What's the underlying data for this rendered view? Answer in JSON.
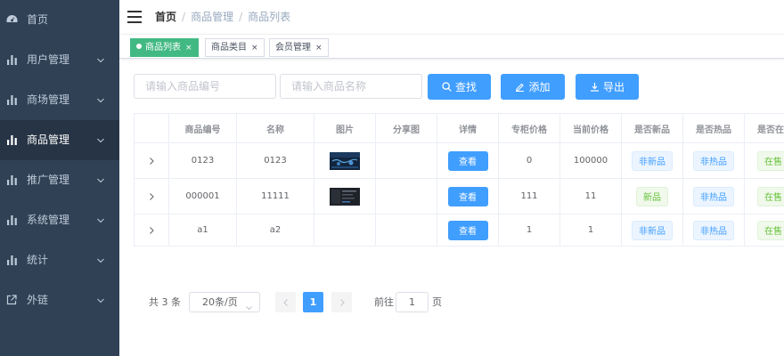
{
  "sidebar": {
    "items": [
      {
        "label": "首页",
        "icon": "dashboard-icon",
        "arrow": false
      },
      {
        "label": "用户管理",
        "icon": "chart-icon",
        "arrow": true
      },
      {
        "label": "商场管理",
        "icon": "chart-icon",
        "arrow": true
      },
      {
        "label": "商品管理",
        "icon": "chart-icon",
        "arrow": true,
        "active": true
      },
      {
        "label": "推广管理",
        "icon": "chart-icon",
        "arrow": true
      },
      {
        "label": "系统管理",
        "icon": "chart-icon",
        "arrow": true
      },
      {
        "label": "统计",
        "icon": "chart-icon",
        "arrow": true
      },
      {
        "label": "外链",
        "icon": "external-link-icon",
        "arrow": true
      }
    ]
  },
  "breadcrumb": [
    "首页",
    "商品管理",
    "商品列表"
  ],
  "tags": [
    {
      "label": "商品列表",
      "active": true
    },
    {
      "label": "商品类目",
      "active": false
    },
    {
      "label": "会员管理",
      "active": false
    }
  ],
  "filters": {
    "code_placeholder": "请输入商品编号",
    "name_placeholder": "请输入商品名称",
    "search_label": "查找",
    "add_label": "添加",
    "export_label": "导出"
  },
  "table": {
    "headers": [
      "",
      "商品编号",
      "名称",
      "图片",
      "分享图",
      "详情",
      "专柜价格",
      "当前价格",
      "是否新品",
      "是否热品",
      "是否在售"
    ],
    "view_label": "查看",
    "rows": [
      {
        "code": "0123",
        "name": "0123",
        "counter_price": "0",
        "current_price": "100000",
        "is_new": "非新品",
        "is_hot": "非热品",
        "on_sale": "在售"
      },
      {
        "code": "000001",
        "name": "11111",
        "counter_price": "111",
        "current_price": "11",
        "is_new": "新品",
        "is_hot": "非热品",
        "on_sale": "在售"
      },
      {
        "code": "a1",
        "name": "a2",
        "counter_price": "1",
        "current_price": "1",
        "is_new": "非新品",
        "is_hot": "非热品",
        "on_sale": "在售"
      }
    ]
  },
  "pagination": {
    "total": "共 3 条",
    "page_size": "20条/页",
    "current_page": "1",
    "goto_prefix": "前往",
    "goto_value": "1",
    "goto_suffix": "页"
  },
  "colors": {
    "sidebar_bg": "#304156",
    "primary": "#409eff",
    "tag_active": "#42b983"
  }
}
